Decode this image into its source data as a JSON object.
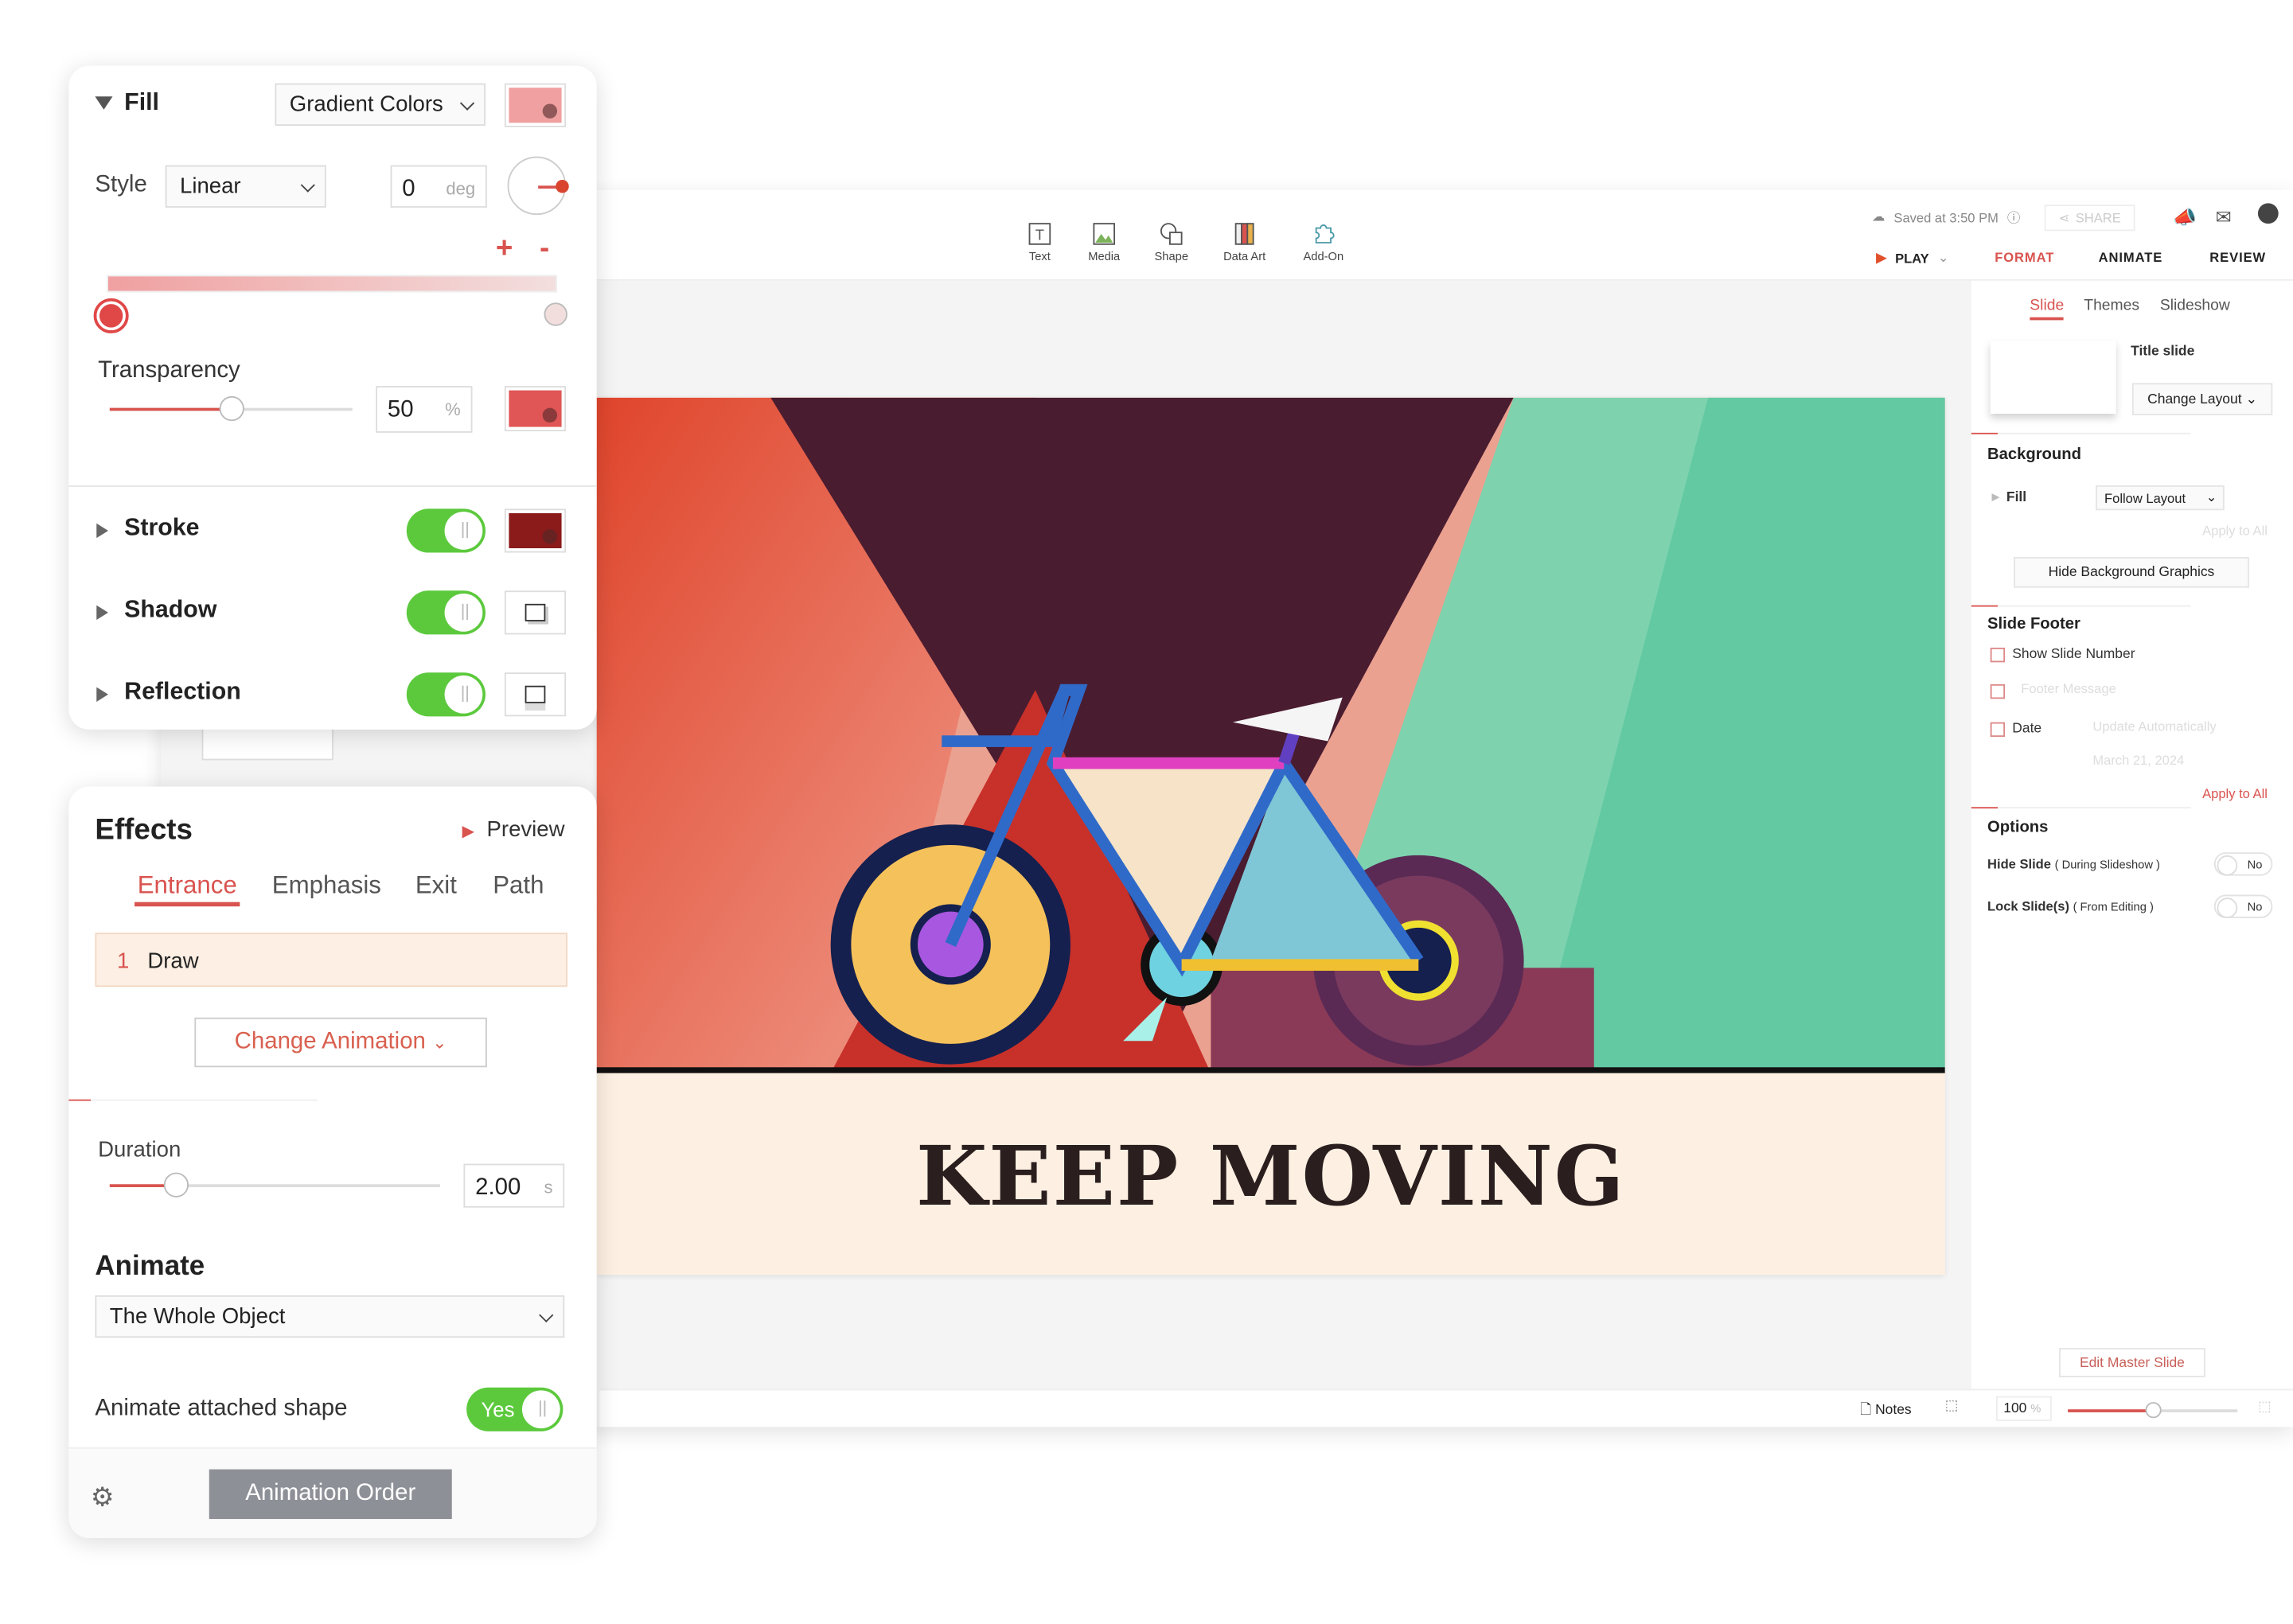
{
  "toolbar": {
    "items": [
      {
        "label": "Text",
        "icon": "text-box-icon"
      },
      {
        "label": "Media",
        "icon": "image-icon"
      },
      {
        "label": "Shape",
        "icon": "shape-icon"
      },
      {
        "label": "Data Art",
        "icon": "data-art-icon"
      },
      {
        "label": "Add-On",
        "icon": "puzzle-icon"
      }
    ]
  },
  "header": {
    "saved": "Saved at 3:50 PM",
    "share": "SHARE",
    "play": "PLAY"
  },
  "right_tabs": [
    "FORMAT",
    "ANIMATE",
    "REVIEW"
  ],
  "right_panel": {
    "subtabs": [
      "Slide",
      "Themes",
      "Slideshow"
    ],
    "layout_name": "Title slide",
    "change_layout": "Change Layout",
    "background": {
      "title": "Background",
      "fill_label": "Fill",
      "fill_value": "Follow Layout",
      "apply_all": "Apply to All",
      "hide_bg": "Hide Background Graphics"
    },
    "footer": {
      "title": "Slide Footer",
      "show_number": "Show Slide Number",
      "footer_message": "Footer Message",
      "date": "Date",
      "date_mode": "Update Automatically",
      "date_value": "March 21, 2024",
      "apply_all": "Apply to All"
    },
    "options": {
      "title": "Options",
      "hide_slide": "Hide Slide",
      "hide_slide_note": "( During Slideshow )",
      "hide_value": "No",
      "lock_slide": "Lock Slide(s)",
      "lock_note": "( From Editing )",
      "lock_value": "No"
    },
    "edit_master": "Edit Master Slide"
  },
  "bottom": {
    "notes": "Notes",
    "zoom": "100",
    "zoom_unit": "%",
    "zoom_level": 0.5
  },
  "slide": {
    "title": "KEEP MOVING"
  },
  "fill_panel": {
    "fill_label": "Fill",
    "fill_type": "Gradient Colors",
    "style_label": "Style",
    "style_value": "Linear",
    "angle": "0",
    "angle_unit": "deg",
    "plus": "+",
    "minus": "-",
    "transparency_label": "Transparency",
    "transparency": "50",
    "transparency_unit": "%",
    "transparency_level": 0.5,
    "rows": [
      {
        "label": "Stroke",
        "on": true
      },
      {
        "label": "Shadow",
        "on": true
      },
      {
        "label": "Reflection",
        "on": true
      }
    ],
    "colors": {
      "fill": "#f0a0a0",
      "stop_start": "#e04848",
      "stop_end": "#f3dede",
      "transparency": "#e05555",
      "stroke": "#8b1a1a",
      "toggle": "#5cc93d",
      "accent": "#d9534f"
    }
  },
  "effects": {
    "title": "Effects",
    "preview": "Preview",
    "tabs": [
      "Entrance",
      "Emphasis",
      "Exit",
      "Path"
    ],
    "item_index": "1",
    "item_name": "Draw",
    "change_animation": "Change Animation",
    "duration_label": "Duration",
    "duration": "2.00",
    "duration_unit": "s",
    "animate_label": "Animate",
    "animate_value": "The Whole Object",
    "attached_label": "Animate attached shape",
    "attached_value": "Yes",
    "animation_order": "Animation Order"
  }
}
